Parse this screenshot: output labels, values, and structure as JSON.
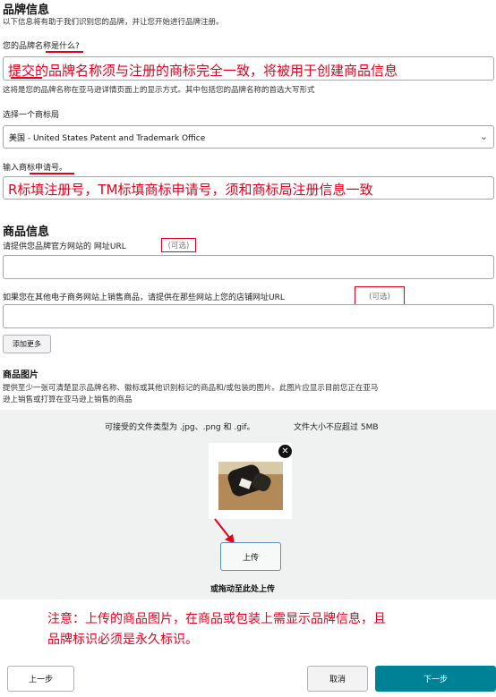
{
  "brand_info": {
    "title": "品牌信息",
    "subtitle": "以下信息将有助于我们识别您的品牌，并让您开始进行品牌注册。",
    "name_question": "您的品牌名称是什么?",
    "name_annotation": "提交的品牌名称须与注册的商标完全一致，将被用于创建商品信息",
    "name_hint": "这将是您的品牌名称在亚马逊详情页面上的显示方式。其中包括您的品牌名称的首选大写形式",
    "office_label": "选择一个商标局",
    "office_value": "美国 - United States Patent and Trademark Office",
    "tm_label": "输入商标申请号。",
    "tm_annotation": "R标填注册号，TM标填商标申请号，须和商标局注册信息一致"
  },
  "product_info": {
    "title": "商品信息",
    "site_label": "请提供您品牌官方网站的 网址URL",
    "optional": "(可选)",
    "store_label": "如果您在其他电子商务网站上销售商品，请提供在那些网站上您的店铺网址URL",
    "add_more": "添加更多"
  },
  "images": {
    "title": "商品图片",
    "desc_line1": "提供至少一张可清楚显示品牌名称、徽标或其他识别标记的商品和/或包装的图片。此图片应显示目前您正在亚马",
    "desc_line2": "逊上销售或打算在亚马逊上销售的商品",
    "file_types": "可接受的文件类型为 .jpg、.png 和 .gif。",
    "file_size": "文件大小不应超过 5MB",
    "upload": "上传",
    "drag": "或拖动至此处上传",
    "note_line1": "注意：上传的商品图片，在商品或包装上需显示品牌信息，且",
    "note_line2": "品牌标识必须是永久标识。"
  },
  "footer": {
    "prev": "上一步",
    "cancel": "取消",
    "next": "下一步"
  },
  "colors": {
    "annotation_red": "#e3001b",
    "next_button": "#008296",
    "upload_area_bg": "#f0f2f2",
    "upload_button_border": "#5b8ec9"
  },
  "icons": [
    "chevron-down-icon",
    "close-icon",
    "arrow-annotation-icon"
  ]
}
